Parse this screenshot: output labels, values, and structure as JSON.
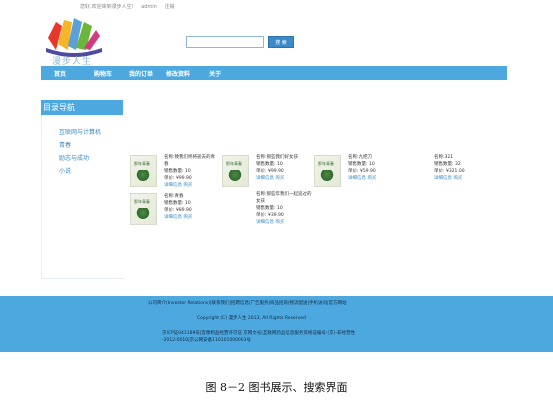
{
  "topbar": {
    "welcome": "您好,欢迎来到漫步人生!",
    "username": "admin",
    "logout": "注销"
  },
  "logo": {
    "text": "漫步人生"
  },
  "search": {
    "placeholder": "",
    "button": "搜 索"
  },
  "nav": {
    "items": [
      "首页",
      "购物车",
      "我的订单",
      "修改资料",
      "关于"
    ]
  },
  "sidebar": {
    "title": "目录导航",
    "categories": [
      "互联网与计算机",
      "青春",
      "励志与成功",
      "小说"
    ]
  },
  "labels": {
    "name": "名称:",
    "sales": "销售数量:",
    "price": "单价:",
    "detail": "详细信息",
    "buy": "购买"
  },
  "books": [
    {
      "name": "致我们终将逝去的青春",
      "sales": "10",
      "price": "¥99.90",
      "cover": "那年青春"
    },
    {
      "name": "那些我们好女孩",
      "sales": "10",
      "price": "¥99.90",
      "cover": "那年青春"
    },
    {
      "name": "九把刀",
      "sales": "10",
      "price": "¥59.90",
      "cover": "那年青春"
    },
    {
      "name": "321",
      "sales": "32",
      "price": "¥321.00",
      "cover": ""
    },
    {
      "name": "青春",
      "sales": "10",
      "price": "¥89.90",
      "cover": "那年青春"
    },
    {
      "name": "那些年我们一起追过的女孩",
      "sales": "10",
      "price": "¥39.90",
      "cover": ""
    }
  ],
  "footer": {
    "links": "公司简介(Investor Relations)|联系我们|招聘信息|广告服务|商品招商|物流配送|手机访问|官方网站",
    "copyright": "Copyright (C) 漫步人生 2013, All Rights Reserved",
    "license": "京ICP证041189号|音像制品经营许可证 京网文号|互联网药品信息服务资格证编号:(京)-非经营性",
    "license2": "-2012-0010|京公网安备110101000003号"
  },
  "caption": "图 8－2  图书展示、搜索界面"
}
